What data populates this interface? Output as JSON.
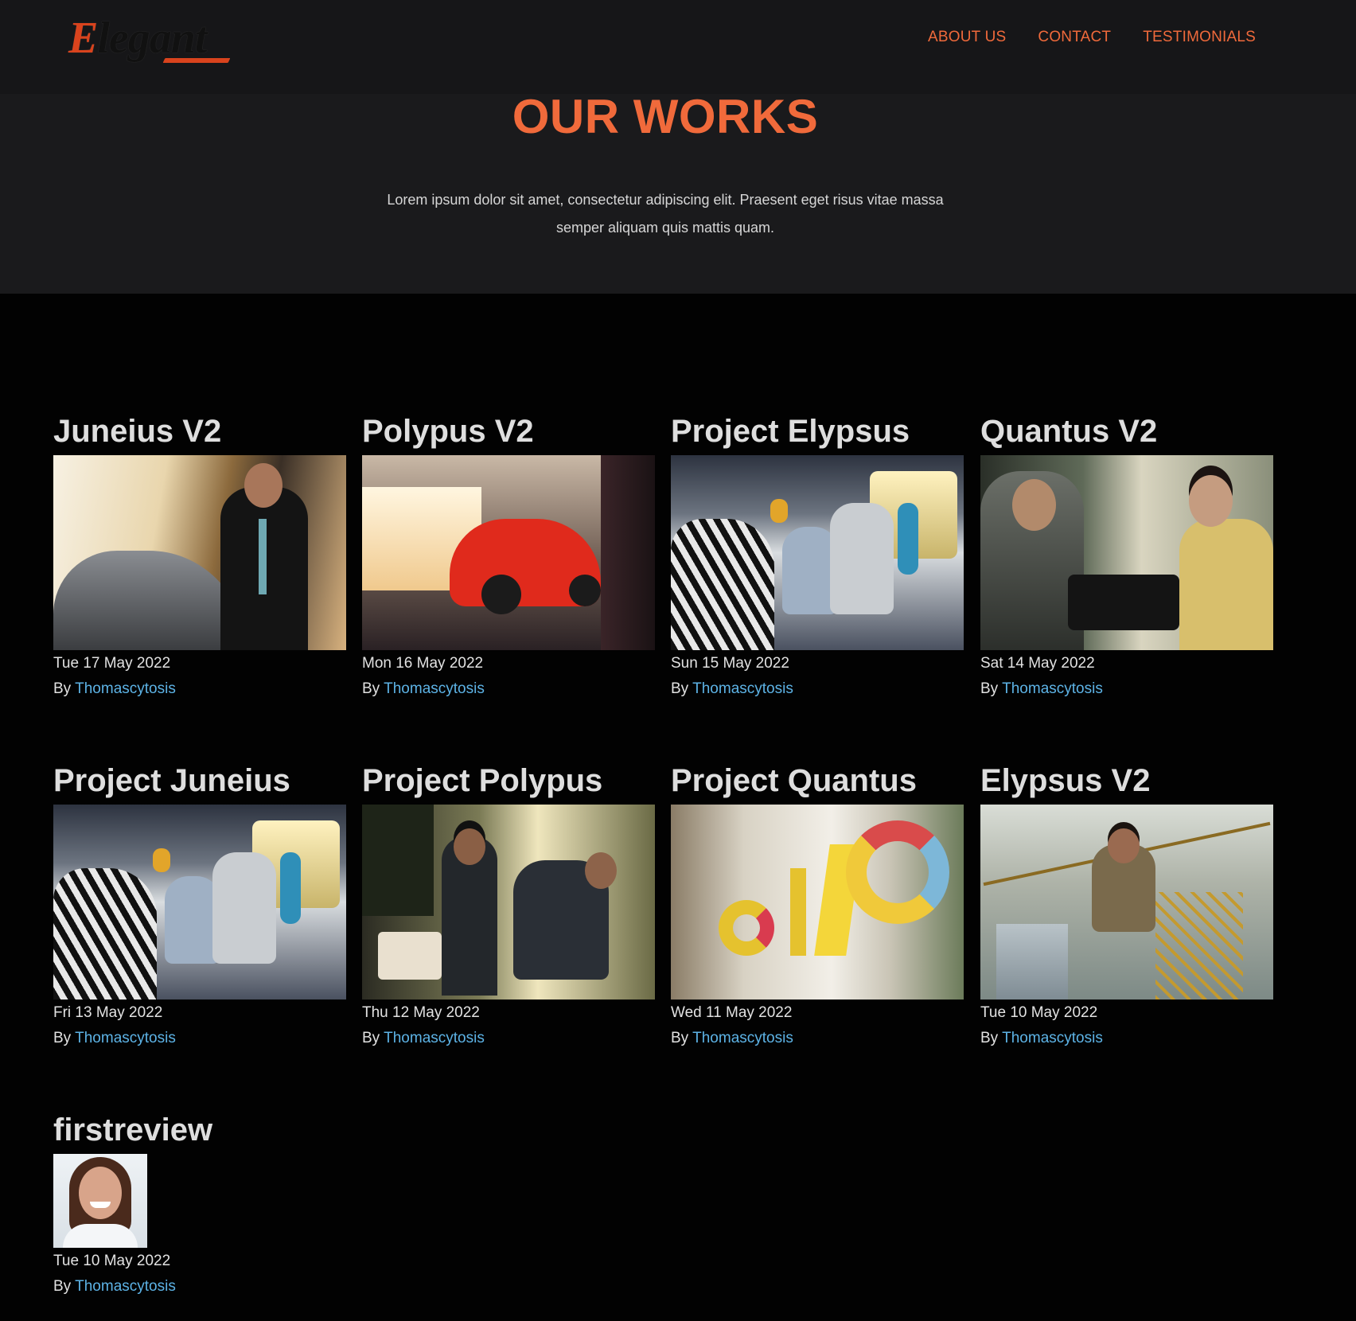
{
  "header": {
    "logo": {
      "text": "Elegant",
      "first_letter": "E",
      "rest": "legant"
    },
    "nav": [
      {
        "label": "ABOUT US"
      },
      {
        "label": "CONTACT"
      },
      {
        "label": "TESTIMONIALS"
      }
    ]
  },
  "hero": {
    "title": "OUR WORKS",
    "text": "Lorem ipsum dolor sit amet, consectetur adipiscing elit. Praesent eget risus vitae massa semper aliquam quis mattis quam."
  },
  "colors": {
    "accent": "#f06a3b",
    "link": "#5db3e6",
    "header_bg": "#161618",
    "page_bg": "#020202"
  },
  "works": [
    {
      "title": "Juneius V2",
      "date": "Tue 17 May 2022",
      "by": "By",
      "author": "Thomascytosis",
      "image": "man-in-leather-jacket-by-car"
    },
    {
      "title": "Polypus V2",
      "date": "Mon 16 May 2022",
      "by": "By",
      "author": "Thomascytosis",
      "image": "red-car-in-garage"
    },
    {
      "title": "Project Elypsus",
      "date": "Sun 15 May 2022",
      "by": "By",
      "author": "Thomascytosis",
      "image": "zebra-and-parrots-on-train"
    },
    {
      "title": "Quantus V2",
      "date": "Sat 14 May 2022",
      "by": "By",
      "author": "Thomascytosis",
      "image": "vintage-typewriter-office"
    },
    {
      "title": "Project Juneius",
      "date": "Fri 13 May 2022",
      "by": "By",
      "author": "Thomascytosis",
      "image": "zebra-and-parrots-on-train"
    },
    {
      "title": "Project Polypus",
      "date": "Thu 12 May 2022",
      "by": "By",
      "author": "Thomascytosis",
      "image": "two-men-in-workshop"
    },
    {
      "title": "Project Quantus",
      "date": "Wed 11 May 2022",
      "by": "By",
      "author": "Thomascytosis",
      "image": "colorful-letters-on-window"
    },
    {
      "title": "Elypsus V2",
      "date": "Tue 10 May 2022",
      "by": "By",
      "author": "Thomascytosis",
      "image": "man-falling-from-crane"
    }
  ],
  "review": {
    "title": "firstreview",
    "date": "Tue 10 May 2022",
    "by": "By",
    "author": "Thomascytosis",
    "image": "smiling-woman-portrait"
  }
}
